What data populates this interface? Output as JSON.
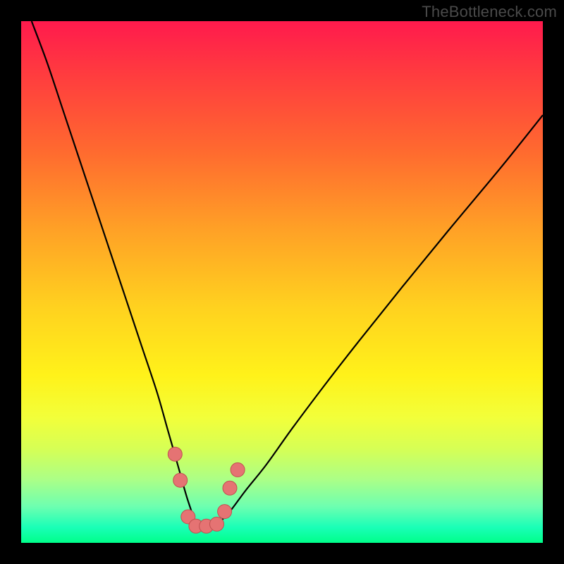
{
  "watermark": "TheBottleneck.com",
  "colors": {
    "frame": "#000000",
    "curve": "#000000",
    "marker_fill": "#e57373",
    "marker_stroke": "#c05050"
  },
  "chart_data": {
    "type": "line",
    "title": "",
    "xlabel": "",
    "ylabel": "",
    "xlim": [
      0,
      100
    ],
    "ylim": [
      0,
      100
    ],
    "grid": false,
    "note": "Axes are unlabeled. Values are normalized positions (percent of plot width/height) estimated from pixel positions. Lower y = bottom of plot; minimum y≈3 at x≈34.",
    "series": [
      {
        "name": "curve",
        "x": [
          2,
          5,
          8,
          11,
          14,
          17,
          20,
          23,
          26,
          28,
          30,
          32,
          34,
          36,
          38,
          40,
          43,
          47,
          52,
          58,
          65,
          73,
          82,
          92,
          100
        ],
        "y": [
          100,
          92,
          83,
          74,
          65,
          56,
          47,
          38,
          29,
          22,
          15,
          8,
          3,
          3,
          4,
          6,
          10,
          15,
          22,
          30,
          39,
          49,
          60,
          72,
          82
        ]
      }
    ],
    "markers": {
      "name": "highlight-points",
      "note": "Salmon circular markers clustered near curve minimum",
      "points": [
        {
          "x": 29.5,
          "y": 17
        },
        {
          "x": 30.5,
          "y": 12
        },
        {
          "x": 32.0,
          "y": 5
        },
        {
          "x": 33.5,
          "y": 3.2
        },
        {
          "x": 35.5,
          "y": 3.2
        },
        {
          "x": 37.5,
          "y": 3.6
        },
        {
          "x": 39.0,
          "y": 6
        },
        {
          "x": 40.0,
          "y": 10.5
        },
        {
          "x": 41.5,
          "y": 14
        }
      ]
    }
  }
}
